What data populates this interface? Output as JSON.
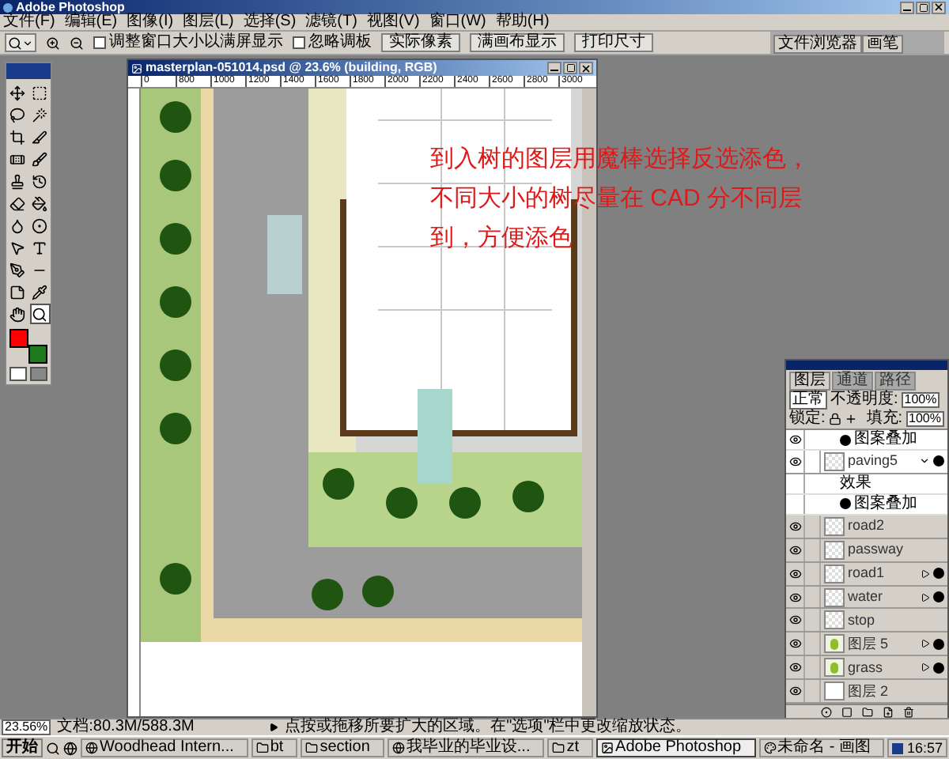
{
  "app": {
    "title": "Adobe Photoshop"
  },
  "menu": [
    "文件(F)",
    "编辑(E)",
    "图像(I)",
    "图层(L)",
    "选择(S)",
    "滤镜(T)",
    "视图(V)",
    "窗口(W)",
    "帮助(H)"
  ],
  "options_bar": {
    "checkboxes": [
      {
        "label": "调整窗口大小以满屏显示",
        "checked": false
      },
      {
        "label": "忽略调板",
        "checked": false
      }
    ],
    "buttons": [
      "实际像素",
      "满画布显示",
      "打印尺寸"
    ],
    "palette_tabs": [
      "文件浏览器",
      "画笔"
    ]
  },
  "toolbox": {
    "tools": [
      {
        "kind": "move",
        "selected": false
      },
      {
        "kind": "marquee",
        "selected": false
      },
      {
        "kind": "lasso",
        "selected": false
      },
      {
        "kind": "wand",
        "selected": false
      },
      {
        "kind": "crop",
        "selected": false
      },
      {
        "kind": "slice",
        "selected": false
      },
      {
        "kind": "heal",
        "selected": false
      },
      {
        "kind": "brush",
        "selected": false
      },
      {
        "kind": "stamp",
        "selected": false
      },
      {
        "kind": "history",
        "selected": false
      },
      {
        "kind": "eraser",
        "selected": false
      },
      {
        "kind": "bucket",
        "selected": false
      },
      {
        "kind": "blur",
        "selected": false
      },
      {
        "kind": "dodge",
        "selected": false
      },
      {
        "kind": "select",
        "selected": false
      },
      {
        "kind": "type",
        "selected": false
      },
      {
        "kind": "pen",
        "selected": false
      },
      {
        "kind": "line",
        "selected": false
      },
      {
        "kind": "notes",
        "selected": false
      },
      {
        "kind": "eyedropper",
        "selected": false
      },
      {
        "kind": "hand",
        "selected": false
      },
      {
        "kind": "zoom",
        "selected": true
      }
    ]
  },
  "document": {
    "title": "masterplan-051014.psd @ 23.6% (building, RGB)",
    "ruler": [
      "0",
      "800",
      "1000",
      "1200",
      "1400",
      "1600",
      "1800",
      "2000",
      "2200",
      "2400",
      "2600",
      "2800",
      "3000"
    ],
    "annotation": [
      "到入树的图层用魔棒选择反选添色，",
      "不同大小的树尽量在 CAD 分不同层",
      "到，方便添色"
    ]
  },
  "layers_panel": {
    "tabs": [
      {
        "label": "图层",
        "selected": true
      },
      {
        "label": "通道",
        "selected": false
      },
      {
        "label": "路径",
        "selected": false
      }
    ],
    "blend_mode": "正常",
    "opacity_label": "不透明度:",
    "opacity": "100%",
    "lock_label": "锁定:",
    "fill_label": "填充:",
    "fill": "100%",
    "layers": [
      {
        "kind": "effect",
        "name": "图案叠加",
        "visible": true
      },
      {
        "kind": "layer",
        "name": "paving5",
        "visible": true,
        "effects": true,
        "expanded": true,
        "artwork": false,
        "opaque": false
      },
      {
        "kind": "effect-header",
        "name": "效果",
        "visible": false
      },
      {
        "kind": "effect",
        "name": "图案叠加",
        "visible": false
      },
      {
        "kind": "layer",
        "name": "road2",
        "visible": true,
        "effects": false,
        "expanded": false,
        "artwork": false,
        "opaque": false
      },
      {
        "kind": "layer",
        "name": "passway",
        "visible": true,
        "effects": false,
        "expanded": false,
        "artwork": false,
        "opaque": false
      },
      {
        "kind": "layer",
        "name": "road1",
        "visible": true,
        "effects": true,
        "expanded": false,
        "artwork": false,
        "opaque": false
      },
      {
        "kind": "layer",
        "name": "water",
        "visible": true,
        "effects": true,
        "expanded": false,
        "artwork": false,
        "opaque": false
      },
      {
        "kind": "layer",
        "name": "stop",
        "visible": true,
        "effects": false,
        "expanded": false,
        "artwork": false,
        "opaque": false
      },
      {
        "kind": "layer",
        "name": "图层 5",
        "visible": true,
        "effects": true,
        "expanded": false,
        "artwork": true,
        "opaque": false
      },
      {
        "kind": "layer",
        "name": "grass",
        "visible": true,
        "effects": true,
        "expanded": false,
        "artwork": true,
        "opaque": false
      },
      {
        "kind": "layer",
        "name": "图层 2",
        "visible": true,
        "effects": false,
        "expanded": false,
        "artwork": false,
        "opaque": true
      }
    ]
  },
  "status_bar": {
    "zoom": "23.56%",
    "doc_size": "文档:80.3M/588.3M",
    "hint": "点按或拖移所要扩大的区域。在\"选项\"栏中更改缩放状态。"
  },
  "taskbar": {
    "start": "开始",
    "items": [
      {
        "label": "Woodhead Intern...",
        "kind": "browser",
        "selected": false
      },
      {
        "label": "bt",
        "kind": "folder",
        "selected": false
      },
      {
        "label": "section",
        "kind": "folder",
        "selected": false
      },
      {
        "label": "我毕业的毕业设...",
        "kind": "browser",
        "selected": false
      },
      {
        "label": "zt",
        "kind": "folder",
        "selected": false
      },
      {
        "label": "Adobe Photoshop",
        "kind": "app",
        "selected": true
      },
      {
        "label": "未命名 - 画图",
        "kind": "paint",
        "selected": false
      }
    ],
    "clock": "16:57"
  }
}
